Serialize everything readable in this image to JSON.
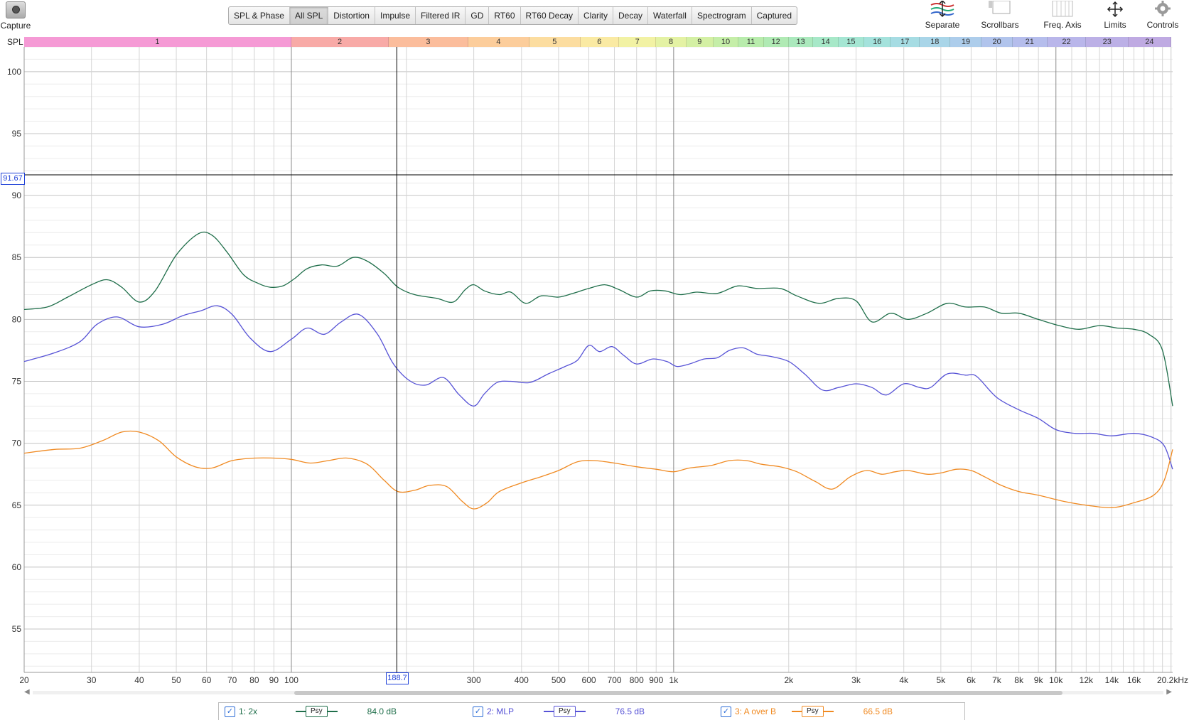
{
  "toolbar": {
    "capture_label": "Capture",
    "tabs": [
      "SPL & Phase",
      "All SPL",
      "Distortion",
      "Impulse",
      "Filtered IR",
      "GD",
      "RT60",
      "RT60 Decay",
      "Clarity",
      "Decay",
      "Waterfall",
      "Spectrogram",
      "Captured"
    ],
    "active_tab": "All SPL",
    "tools": [
      {
        "label": "Separate",
        "icon": "separate-icon"
      },
      {
        "label": "Scrollbars",
        "icon": "scrollbars-icon"
      },
      {
        "label": "Freq. Axis",
        "icon": "freq-axis-icon"
      },
      {
        "label": "Limits",
        "icon": "limits-icon"
      },
      {
        "label": "Controls",
        "icon": "gear-icon"
      }
    ]
  },
  "bands": {
    "label": "SPL",
    "items": [
      {
        "n": "1",
        "f0": 20,
        "f1": 100,
        "color": "#f59ad5"
      },
      {
        "n": "2",
        "f0": 100,
        "f1": 180,
        "color": "#f8aaa7"
      },
      {
        "n": "3",
        "f0": 180,
        "f1": 290,
        "color": "#fbbd9c"
      },
      {
        "n": "4",
        "f0": 290,
        "f1": 420,
        "color": "#fccd9b"
      },
      {
        "n": "5",
        "f0": 420,
        "f1": 570,
        "color": "#fcdda0"
      },
      {
        "n": "6",
        "f0": 570,
        "f1": 720,
        "color": "#faeaa3"
      },
      {
        "n": "7",
        "f0": 720,
        "f1": 900,
        "color": "#f2f2a4"
      },
      {
        "n": "8",
        "f0": 900,
        "f1": 1080,
        "color": "#e4f2a4"
      },
      {
        "n": "9",
        "f0": 1080,
        "f1": 1270,
        "color": "#d4f0a4"
      },
      {
        "n": "10",
        "f0": 1270,
        "f1": 1480,
        "color": "#c5eea8"
      },
      {
        "n": "11",
        "f0": 1480,
        "f1": 1720,
        "color": "#b8ecac"
      },
      {
        "n": "12",
        "f0": 1720,
        "f1": 2000,
        "color": "#b0eab4"
      },
      {
        "n": "13",
        "f0": 2000,
        "f1": 2320,
        "color": "#abe9bd"
      },
      {
        "n": "14",
        "f0": 2320,
        "f1": 2700,
        "color": "#a7e8c8"
      },
      {
        "n": "15",
        "f0": 2700,
        "f1": 3150,
        "color": "#a5e6d3"
      },
      {
        "n": "16",
        "f0": 3150,
        "f1": 3700,
        "color": "#a4e2dc"
      },
      {
        "n": "17",
        "f0": 3700,
        "f1": 4400,
        "color": "#a6dce3"
      },
      {
        "n": "18",
        "f0": 4400,
        "f1": 5300,
        "color": "#a9d5e8"
      },
      {
        "n": "19",
        "f0": 5300,
        "f1": 6400,
        "color": "#adcdeb"
      },
      {
        "n": "20",
        "f0": 6400,
        "f1": 7700,
        "color": "#b1c4ec"
      },
      {
        "n": "21",
        "f0": 7700,
        "f1": 9500,
        "color": "#b5bdec"
      },
      {
        "n": "22",
        "f0": 9500,
        "f1": 12000,
        "color": "#b9b6ea"
      },
      {
        "n": "23",
        "f0": 12000,
        "f1": 15500,
        "color": "#bcb0e6"
      },
      {
        "n": "24",
        "f0": 15500,
        "f1": 20000,
        "color": "#bfaae2"
      }
    ]
  },
  "cursor": {
    "y_label": "91.67",
    "x_label": "188.7",
    "freq_hz": 188.7,
    "spl_db": 91.67
  },
  "chart_data": {
    "type": "line",
    "xscale": "log",
    "xlim": [
      20,
      20200
    ],
    "ylim": [
      51.5,
      102
    ],
    "yticks": [
      55,
      60,
      65,
      70,
      75,
      80,
      85,
      90,
      95,
      100
    ],
    "xticks": [
      {
        "v": 20,
        "l": "20"
      },
      {
        "v": 30,
        "l": "30"
      },
      {
        "v": 40,
        "l": "40"
      },
      {
        "v": 50,
        "l": "50"
      },
      {
        "v": 60,
        "l": "60"
      },
      {
        "v": 70,
        "l": "70"
      },
      {
        "v": 80,
        "l": "80"
      },
      {
        "v": 90,
        "l": "90"
      },
      {
        "v": 100,
        "l": "100"
      },
      {
        "v": 200,
        "l": "200"
      },
      {
        "v": 300,
        "l": "300"
      },
      {
        "v": 400,
        "l": "400"
      },
      {
        "v": 500,
        "l": "500"
      },
      {
        "v": 600,
        "l": "600"
      },
      {
        "v": 700,
        "l": "700"
      },
      {
        "v": 800,
        "l": "800"
      },
      {
        "v": 900,
        "l": "900"
      },
      {
        "v": 1000,
        "l": "1k"
      },
      {
        "v": 2000,
        "l": "2k"
      },
      {
        "v": 3000,
        "l": "3k"
      },
      {
        "v": 4000,
        "l": "4k"
      },
      {
        "v": 5000,
        "l": "5k"
      },
      {
        "v": 6000,
        "l": "6k"
      },
      {
        "v": 7000,
        "l": "7k"
      },
      {
        "v": 8000,
        "l": "8k"
      },
      {
        "v": 9000,
        "l": "9k"
      },
      {
        "v": 10000,
        "l": "10k"
      },
      {
        "v": 12000,
        "l": "12k"
      },
      {
        "v": 14000,
        "l": "14k"
      },
      {
        "v": 16000,
        "l": "16k"
      },
      {
        "v": 20200,
        "l": "20.2kHz"
      }
    ],
    "series": [
      {
        "name": "1: 2x",
        "color": "#1f6e4a",
        "psy_value": "84.0 dB",
        "points": [
          [
            20,
            80.8
          ],
          [
            23,
            81
          ],
          [
            26,
            81.8
          ],
          [
            30,
            82.8
          ],
          [
            33,
            83.2
          ],
          [
            36,
            82.6
          ],
          [
            40,
            81.4
          ],
          [
            44,
            82.3
          ],
          [
            50,
            85.2
          ],
          [
            57,
            86.9
          ],
          [
            62,
            86.8
          ],
          [
            68,
            85.4
          ],
          [
            75,
            83.6
          ],
          [
            82,
            82.9
          ],
          [
            88,
            82.6
          ],
          [
            95,
            82.7
          ],
          [
            102,
            83.3
          ],
          [
            110,
            84.1
          ],
          [
            120,
            84.4
          ],
          [
            132,
            84.3
          ],
          [
            145,
            85
          ],
          [
            158,
            84.7
          ],
          [
            175,
            83.7
          ],
          [
            190,
            82.6
          ],
          [
            210,
            82
          ],
          [
            240,
            81.7
          ],
          [
            265,
            81.4
          ],
          [
            285,
            82.4
          ],
          [
            300,
            82.8
          ],
          [
            320,
            82.3
          ],
          [
            350,
            82
          ],
          [
            375,
            82.2
          ],
          [
            410,
            81.3
          ],
          [
            450,
            81.9
          ],
          [
            500,
            81.8
          ],
          [
            545,
            82.1
          ],
          [
            600,
            82.5
          ],
          [
            660,
            82.8
          ],
          [
            720,
            82.4
          ],
          [
            800,
            81.8
          ],
          [
            870,
            82.3
          ],
          [
            950,
            82.3
          ],
          [
            1040,
            82
          ],
          [
            1150,
            82.2
          ],
          [
            1300,
            82.1
          ],
          [
            1470,
            82.7
          ],
          [
            1650,
            82.5
          ],
          [
            1900,
            82.5
          ],
          [
            2100,
            81.9
          ],
          [
            2400,
            81.3
          ],
          [
            2700,
            81.7
          ],
          [
            3000,
            81.5
          ],
          [
            3300,
            79.8
          ],
          [
            3700,
            80.5
          ],
          [
            4100,
            80
          ],
          [
            4600,
            80.5
          ],
          [
            5200,
            81.3
          ],
          [
            5800,
            81
          ],
          [
            6500,
            81
          ],
          [
            7200,
            80.5
          ],
          [
            8000,
            80.5
          ],
          [
            9000,
            80
          ],
          [
            10200,
            79.5
          ],
          [
            11500,
            79.2
          ],
          [
            13000,
            79.5
          ],
          [
            14500,
            79.3
          ],
          [
            16000,
            79.2
          ],
          [
            17500,
            78.8
          ],
          [
            19000,
            77.5
          ],
          [
            20200,
            73
          ]
        ]
      },
      {
        "name": "2: MLP",
        "color": "#5753d6",
        "psy_value": "76.5 dB",
        "points": [
          [
            20,
            76.6
          ],
          [
            24,
            77.3
          ],
          [
            28,
            78.2
          ],
          [
            31,
            79.6
          ],
          [
            35,
            80.2
          ],
          [
            40,
            79.4
          ],
          [
            46,
            79.6
          ],
          [
            52,
            80.3
          ],
          [
            58,
            80.7
          ],
          [
            64,
            81.1
          ],
          [
            70,
            80.4
          ],
          [
            78,
            78.5
          ],
          [
            88,
            77.4
          ],
          [
            100,
            78.4
          ],
          [
            110,
            79.3
          ],
          [
            122,
            78.8
          ],
          [
            135,
            79.8
          ],
          [
            150,
            80.4
          ],
          [
            168,
            78.8
          ],
          [
            185,
            76.4
          ],
          [
            205,
            75
          ],
          [
            225,
            74.7
          ],
          [
            250,
            75.3
          ],
          [
            275,
            73.9
          ],
          [
            300,
            73
          ],
          [
            320,
            74
          ],
          [
            345,
            74.9
          ],
          [
            375,
            75
          ],
          [
            420,
            74.9
          ],
          [
            470,
            75.6
          ],
          [
            520,
            76.2
          ],
          [
            560,
            76.7
          ],
          [
            600,
            77.9
          ],
          [
            640,
            77.4
          ],
          [
            690,
            77.8
          ],
          [
            740,
            77.1
          ],
          [
            800,
            76.4
          ],
          [
            880,
            76.8
          ],
          [
            960,
            76.6
          ],
          [
            1020,
            76.2
          ],
          [
            1100,
            76.4
          ],
          [
            1200,
            76.8
          ],
          [
            1300,
            76.9
          ],
          [
            1400,
            77.5
          ],
          [
            1520,
            77.7
          ],
          [
            1650,
            77.2
          ],
          [
            1800,
            77
          ],
          [
            2000,
            76.6
          ],
          [
            2200,
            75.6
          ],
          [
            2450,
            74.3
          ],
          [
            2700,
            74.5
          ],
          [
            3000,
            74.8
          ],
          [
            3300,
            74.5
          ],
          [
            3600,
            73.9
          ],
          [
            4000,
            74.8
          ],
          [
            4400,
            74.5
          ],
          [
            4700,
            74.5
          ],
          [
            5200,
            75.6
          ],
          [
            5800,
            75.5
          ],
          [
            6200,
            75.4
          ],
          [
            7000,
            73.7
          ],
          [
            8000,
            72.7
          ],
          [
            9000,
            72
          ],
          [
            10000,
            71.1
          ],
          [
            11200,
            70.8
          ],
          [
            12500,
            70.8
          ],
          [
            14000,
            70.6
          ],
          [
            16000,
            70.8
          ],
          [
            17800,
            70.5
          ],
          [
            19200,
            69.8
          ],
          [
            20200,
            67.9
          ]
        ]
      },
      {
        "name": "3: A over B",
        "color": "#f08a22",
        "psy_value": "66.5 dB",
        "points": [
          [
            20,
            69.2
          ],
          [
            24,
            69.5
          ],
          [
            28,
            69.6
          ],
          [
            32,
            70.2
          ],
          [
            36,
            70.9
          ],
          [
            40,
            70.9
          ],
          [
            45,
            70.2
          ],
          [
            50,
            68.9
          ],
          [
            56,
            68.1
          ],
          [
            62,
            68
          ],
          [
            70,
            68.6
          ],
          [
            80,
            68.8
          ],
          [
            90,
            68.8
          ],
          [
            100,
            68.7
          ],
          [
            112,
            68.4
          ],
          [
            125,
            68.6
          ],
          [
            140,
            68.8
          ],
          [
            158,
            68.3
          ],
          [
            175,
            67
          ],
          [
            190,
            66.1
          ],
          [
            210,
            66.2
          ],
          [
            230,
            66.6
          ],
          [
            255,
            66.5
          ],
          [
            280,
            65.3
          ],
          [
            300,
            64.7
          ],
          [
            325,
            65.2
          ],
          [
            350,
            66.1
          ],
          [
            400,
            66.8
          ],
          [
            450,
            67.3
          ],
          [
            500,
            67.8
          ],
          [
            560,
            68.5
          ],
          [
            620,
            68.6
          ],
          [
            700,
            68.4
          ],
          [
            800,
            68.1
          ],
          [
            900,
            67.9
          ],
          [
            1000,
            67.7
          ],
          [
            1100,
            68
          ],
          [
            1250,
            68.2
          ],
          [
            1400,
            68.6
          ],
          [
            1550,
            68.6
          ],
          [
            1700,
            68.3
          ],
          [
            1900,
            68.1
          ],
          [
            2100,
            67.7
          ],
          [
            2350,
            66.9
          ],
          [
            2600,
            66.3
          ],
          [
            2900,
            67.3
          ],
          [
            3200,
            67.8
          ],
          [
            3500,
            67.5
          ],
          [
            3800,
            67.7
          ],
          [
            4100,
            67.8
          ],
          [
            4600,
            67.5
          ],
          [
            5000,
            67.6
          ],
          [
            5500,
            67.9
          ],
          [
            6000,
            67.8
          ],
          [
            6500,
            67.3
          ],
          [
            7200,
            66.6
          ],
          [
            8000,
            66.1
          ],
          [
            9000,
            65.8
          ],
          [
            10500,
            65.3
          ],
          [
            12000,
            65
          ],
          [
            14000,
            64.8
          ],
          [
            16000,
            65.2
          ],
          [
            18000,
            65.8
          ],
          [
            19200,
            67
          ],
          [
            20200,
            69.5
          ]
        ]
      }
    ]
  }
}
